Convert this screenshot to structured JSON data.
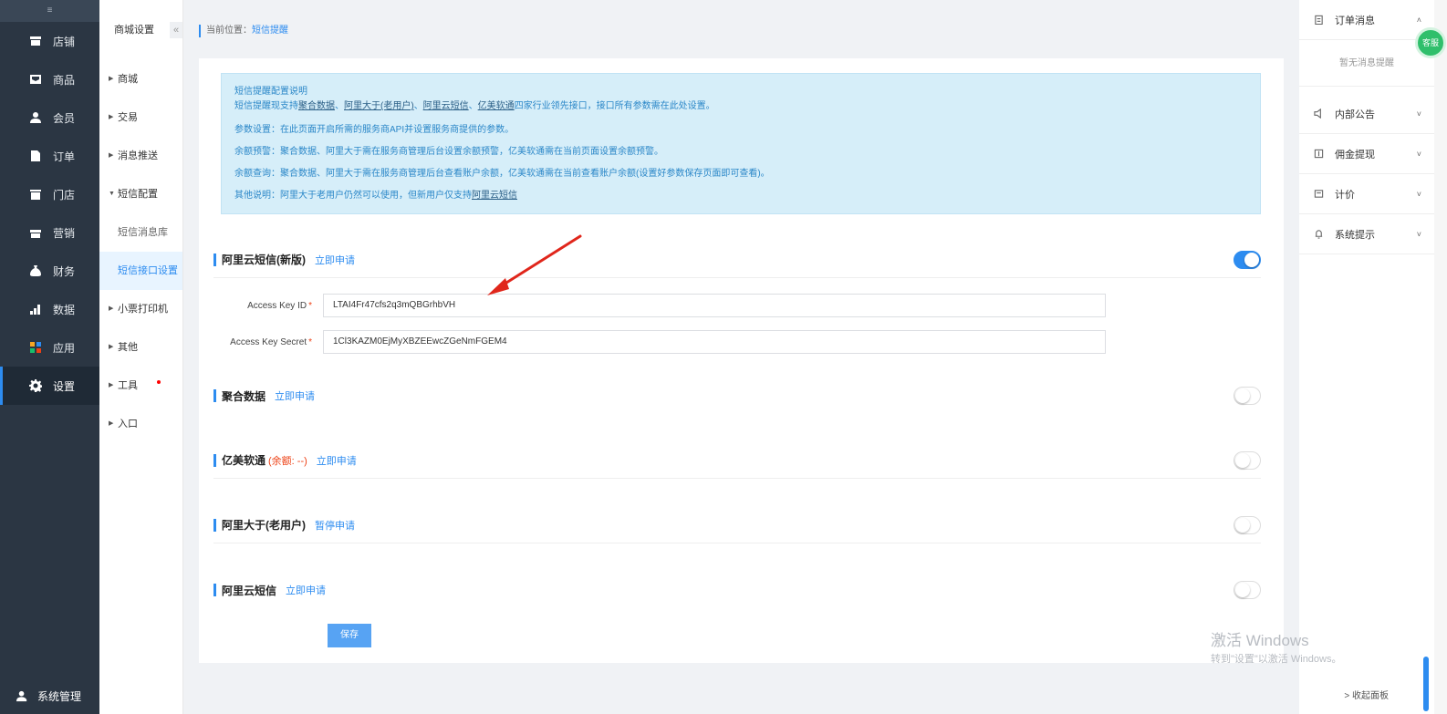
{
  "sidebar": {
    "collapse_glyph": "≡",
    "items": [
      {
        "label": "店铺",
        "icon": "store-icon"
      },
      {
        "label": "商品",
        "icon": "goods-icon"
      },
      {
        "label": "会员",
        "icon": "member-icon"
      },
      {
        "label": "订单",
        "icon": "order-icon"
      },
      {
        "label": "门店",
        "icon": "shop-icon"
      },
      {
        "label": "营销",
        "icon": "gift-icon"
      },
      {
        "label": "财务",
        "icon": "money-bag-icon"
      },
      {
        "label": "数据",
        "icon": "chart-icon"
      },
      {
        "label": "应用",
        "icon": "apps-icon"
      },
      {
        "label": "设置",
        "icon": "gear-icon",
        "active": true
      }
    ],
    "bottom_label": "系统管理"
  },
  "submenu": {
    "title": "商城设置",
    "collapse_glyph": "«",
    "items": [
      {
        "label": "商城",
        "arrow": "▶"
      },
      {
        "label": "交易",
        "arrow": "▶"
      },
      {
        "label": "消息推送",
        "arrow": "▶"
      },
      {
        "label": "短信配置",
        "arrow": "▼"
      },
      {
        "label": "短信消息库"
      },
      {
        "label": "短信接口设置"
      },
      {
        "label": "小票打印机",
        "arrow": "▶"
      },
      {
        "label": "其他",
        "arrow": "▶"
      },
      {
        "label": "工具",
        "arrow": "▶"
      },
      {
        "label": "入口",
        "arrow": "▶"
      }
    ]
  },
  "breadcrumb": {
    "prefix": "当前位置：",
    "current": "短信提醒"
  },
  "notice": {
    "title": "短信提醒配置说明",
    "line1_prefix": "短信提醒现支持",
    "line1_p1": "聚合数据",
    "line1_sep1": "、",
    "line1_p2": "阿里大于(老用户)",
    "line1_sep2": "、",
    "line1_p3": "阿里云短信",
    "line1_sep3": "、",
    "line1_p4": "亿美软通",
    "line1_suffix": "四家行业领先接口，接口所有参数需在此处设置。",
    "line2": "参数设置：在此页面开启所需的服务商API并设置服务商提供的参数。",
    "line3": "余额预警：聚合数据、阿里大于需在服务商管理后台设置余额预警，亿美软通需在当前页面设置余额预警。",
    "line4": "余额查询：聚合数据、阿里大于需在服务商管理后台查看账户余额，亿美软通需在当前查看账户余额(设置好参数保存页面即可查看)。",
    "line5_prefix": "其他说明：阿里大于老用户仍然可以使用，但新用户仅支持",
    "line5_link": "阿里云短信"
  },
  "sections": {
    "aliyun_new": {
      "title": "阿里云短信(新版)",
      "link": "立即申请",
      "enabled": true
    },
    "juhe": {
      "title": "聚合数据",
      "link": "立即申请",
      "enabled": false
    },
    "yimei": {
      "title": "亿美软通",
      "extra": "(余额: --)",
      "link": "立即申请",
      "enabled": false
    },
    "alidayu": {
      "title": "阿里大于(老用户)",
      "link": "暂停申请",
      "enabled": false
    },
    "aliyun": {
      "title": "阿里云短信",
      "link": "立即申请",
      "enabled": false
    }
  },
  "form": {
    "access_key_id_label": "Access Key ID",
    "access_key_id_value": "LTAI4Fr47cfs2q3mQBGrhbVH",
    "access_key_secret_label": "Access Key Secret",
    "access_key_secret_value": "1Cl3KAZM0EjMyXBZEEwcZGeNmFGEM4",
    "required_mark": "*"
  },
  "save_label": "保存",
  "right_panel": {
    "items": [
      {
        "label": "订单消息",
        "icon": "clipboard-icon"
      },
      {
        "label": "内部公告",
        "icon": "speaker-icon"
      },
      {
        "label": "佣金提现",
        "icon": "wallet-icon"
      },
      {
        "label": "计价",
        "icon": "calculator-icon"
      },
      {
        "label": "系统提示",
        "icon": "bell-icon"
      }
    ],
    "empty_text": "暂无消息提醒",
    "collapse_label": "> 收起面板"
  },
  "badge_text": "客服",
  "watermark": {
    "line1": "激活 Windows",
    "line2": "转到\"设置\"以激活 Windows。"
  },
  "colors": {
    "accent": "#2d8cf0",
    "sidebar_bg": "#2b3643",
    "notice_bg": "#d6eef9",
    "annotation_arrow": "#e0261b"
  }
}
